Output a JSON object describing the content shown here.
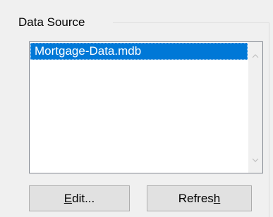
{
  "group": {
    "title": "Data Source"
  },
  "listbox": {
    "items": [
      {
        "label": "Mortgage-Data.mdb",
        "selected": true
      }
    ]
  },
  "scrollbar": {
    "up_icon": "chevron-up-icon",
    "down_icon": "chevron-down-icon"
  },
  "buttons": {
    "edit": {
      "mnemonic": "E",
      "rest": "dit..."
    },
    "refresh": {
      "before_mnemonic": "Refres",
      "mnemonic": "h"
    }
  },
  "colors": {
    "selection": "#0078d7",
    "selection_text": "#ffffff",
    "window_bg": "#f0f0f0"
  }
}
